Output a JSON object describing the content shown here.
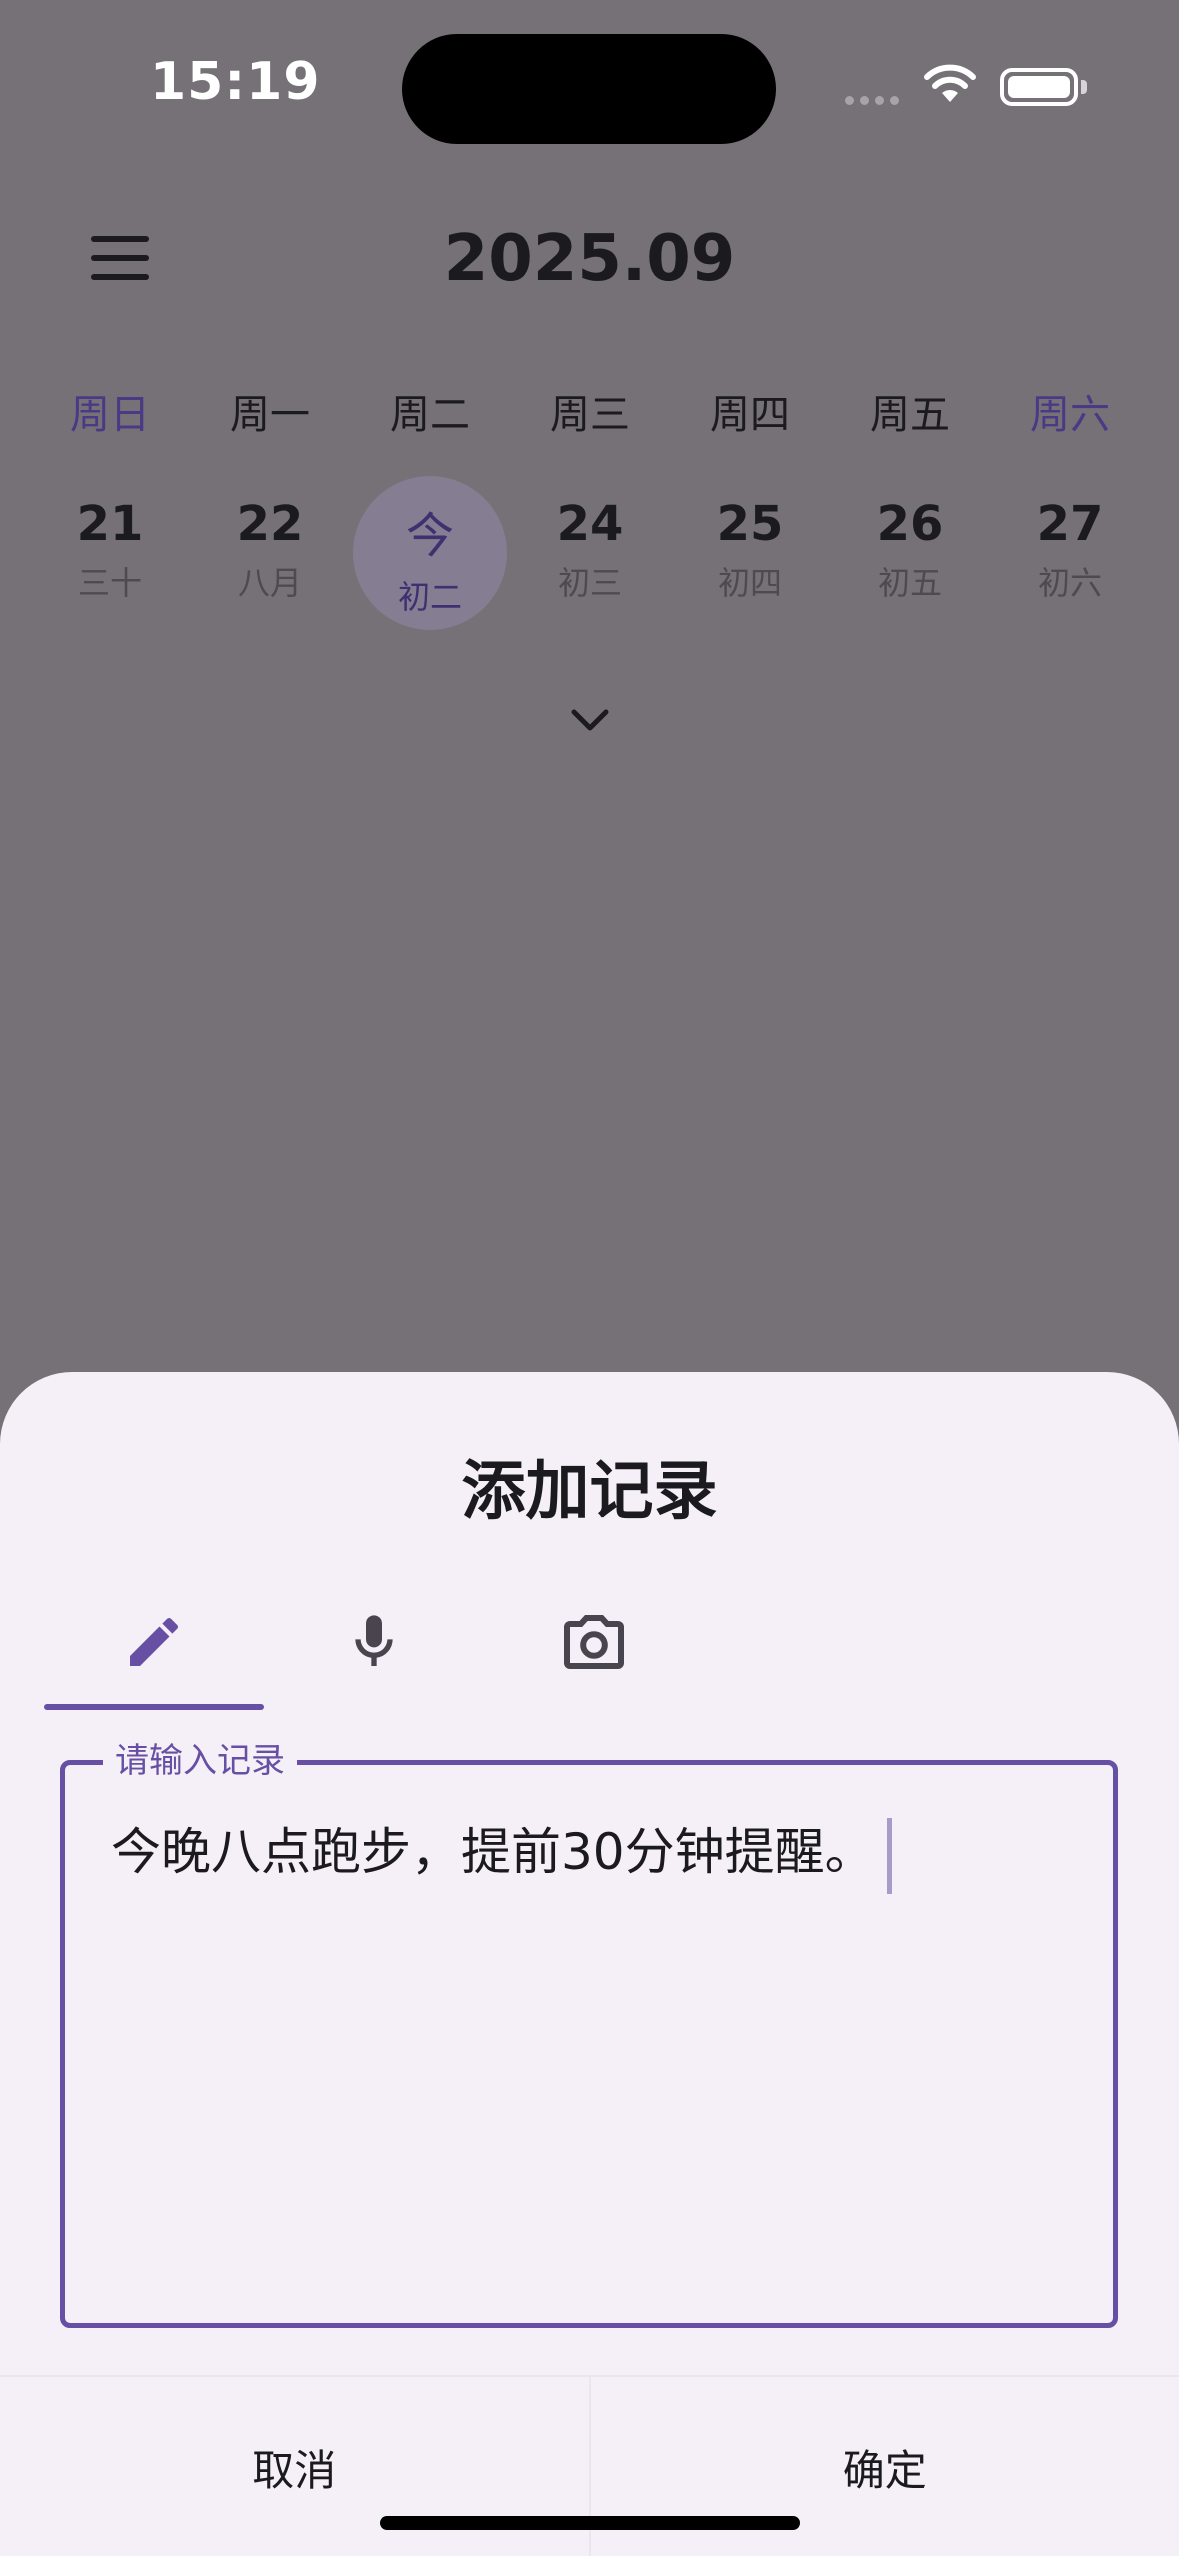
{
  "status_bar": {
    "time": "15:19"
  },
  "header": {
    "month": "2025.09",
    "menu_icon": "menu-icon"
  },
  "week": {
    "days": [
      {
        "weekday": "周日",
        "weekend": true,
        "date": "21",
        "lunar": "三十"
      },
      {
        "weekday": "周一",
        "weekend": false,
        "date": "22",
        "lunar": "八月"
      },
      {
        "weekday": "周二",
        "weekend": false,
        "date": "今",
        "lunar": "初二",
        "today": true
      },
      {
        "weekday": "周三",
        "weekend": false,
        "date": "24",
        "lunar": "初三"
      },
      {
        "weekday": "周四",
        "weekend": false,
        "date": "25",
        "lunar": "初四"
      },
      {
        "weekday": "周五",
        "weekend": false,
        "date": "26",
        "lunar": "初五"
      },
      {
        "weekday": "周六",
        "weekend": true,
        "date": "27",
        "lunar": "初六"
      }
    ],
    "expand_icon": "chevron-down-icon"
  },
  "sheet": {
    "title": "添加记录",
    "tabs": [
      {
        "icon": "pencil-icon",
        "selected": true
      },
      {
        "icon": "microphone-icon",
        "selected": false
      },
      {
        "icon": "camera-icon",
        "selected": false
      }
    ],
    "input": {
      "label": "请输入记录",
      "value": "今晚八点跑步，提前30分钟提醒。"
    },
    "cancel_label": "取消",
    "confirm_label": "确定"
  },
  "colors": {
    "accent": "#6750a4",
    "scrim_background": "#767176",
    "sheet_background": "#f5f0f7",
    "weekend_text": "#4a3a86"
  }
}
